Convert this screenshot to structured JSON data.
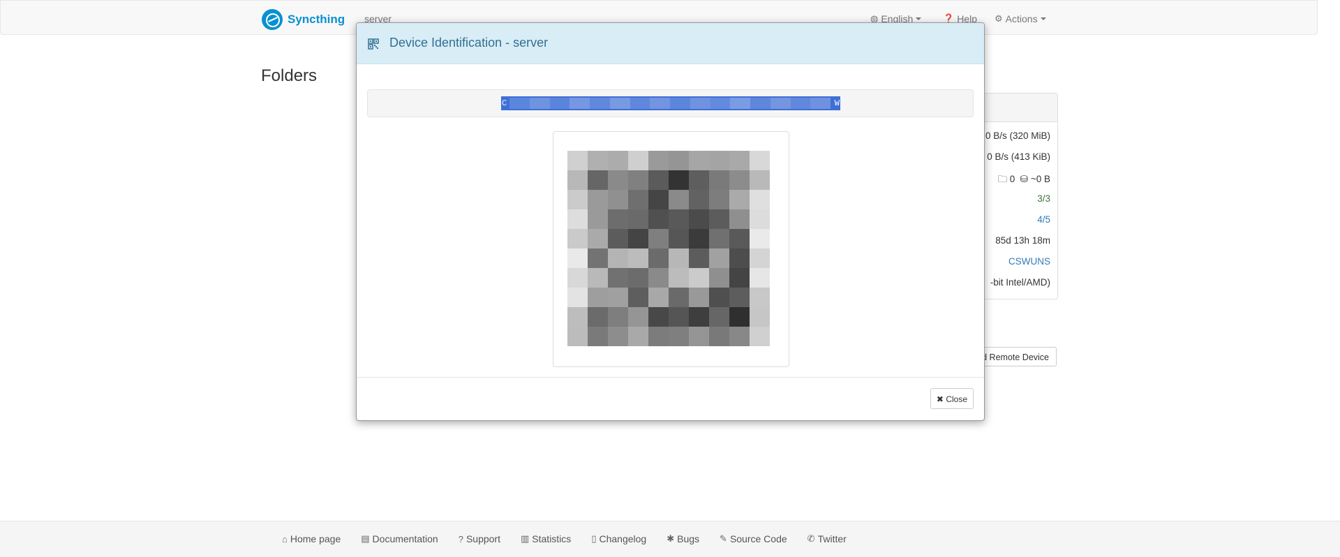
{
  "navbar": {
    "brand": "Syncthing",
    "device_name": "server",
    "language": "English",
    "help": "Help",
    "actions": "Actions"
  },
  "page": {
    "folders_heading": "Folders"
  },
  "device_panel": {
    "download_rate": "0 B/s (320 MiB)",
    "upload_rate": "0 B/s (413 KiB)",
    "local_state_dirs": "0",
    "local_state_size": "~0 B",
    "listeners": "3/3",
    "discovery": "4/5",
    "uptime": "85d 13h 18m",
    "identification": "CSWUNS",
    "version_partial": "-bit Intel/AMD)",
    "add_remote_device_label": "dd Remote Device"
  },
  "modal": {
    "title": "Device Identification - server",
    "device_id_start": "C",
    "device_id_end": "W",
    "close_label": "Close"
  },
  "footer": {
    "links": [
      "Home page",
      "Documentation",
      "Support",
      "Statistics",
      "Changelog",
      "Bugs",
      "Source Code",
      "Twitter"
    ]
  }
}
